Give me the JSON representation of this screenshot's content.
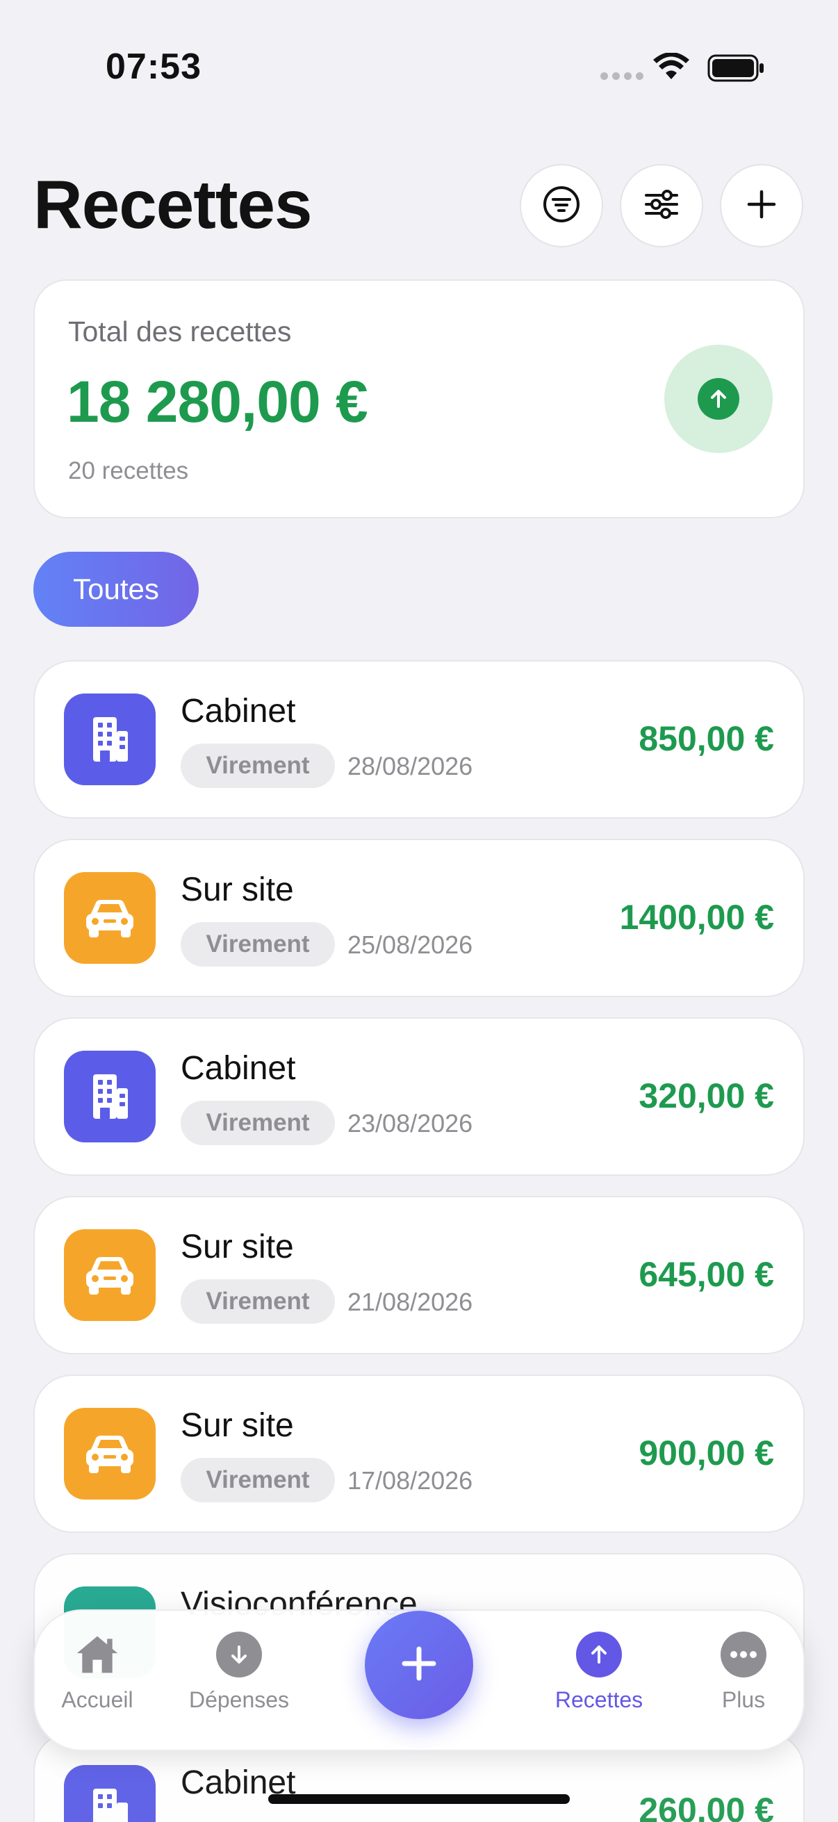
{
  "status_bar": {
    "time": "07:53"
  },
  "header": {
    "title": "Recettes",
    "buttons": [
      {
        "icon": "filter-list-icon"
      },
      {
        "icon": "sliders-icon"
      },
      {
        "icon": "plus-icon"
      }
    ]
  },
  "summary": {
    "label": "Total des recettes",
    "amount": "18 280,00 €",
    "count": "20 recettes",
    "icon": "arrow-up-circle-icon",
    "color": "#1e9a4f"
  },
  "filters": {
    "active_label": "Toutes"
  },
  "transactions": [
    {
      "title": "Cabinet",
      "method": "Virement",
      "date": "28/08/2026",
      "amount": "850,00 €",
      "icon": "building-icon",
      "icon_color": "#5b5de8"
    },
    {
      "title": "Sur site",
      "method": "Virement",
      "date": "25/08/2026",
      "amount": "1400,00 €",
      "icon": "car-icon",
      "icon_color": "#f5a62a"
    },
    {
      "title": "Cabinet",
      "method": "Virement",
      "date": "23/08/2026",
      "amount": "320,00 €",
      "icon": "building-icon",
      "icon_color": "#5b5de8"
    },
    {
      "title": "Sur site",
      "method": "Virement",
      "date": "21/08/2026",
      "amount": "645,00 €",
      "icon": "car-icon",
      "icon_color": "#f5a62a"
    },
    {
      "title": "Sur site",
      "method": "Virement",
      "date": "17/08/2026",
      "amount": "900,00 €",
      "icon": "car-icon",
      "icon_color": "#f5a62a"
    },
    {
      "title": "Visioconférence",
      "icon": "video-icon",
      "icon_color": "#1fa88e"
    },
    {
      "title": "Cabinet",
      "amount": "260,00 €",
      "icon": "building-icon",
      "icon_color": "#5b5de8"
    }
  ],
  "tab_bar": {
    "tabs": [
      {
        "label": "Accueil",
        "icon": "home-icon"
      },
      {
        "label": "Dépenses",
        "icon": "arrow-down-circle-icon"
      },
      {
        "label": "Recettes",
        "icon": "arrow-up-circle-icon",
        "active": true
      },
      {
        "label": "Plus",
        "icon": "more-icon"
      }
    ],
    "accent": "#6358e6",
    "fab_icon": "plus-icon"
  }
}
